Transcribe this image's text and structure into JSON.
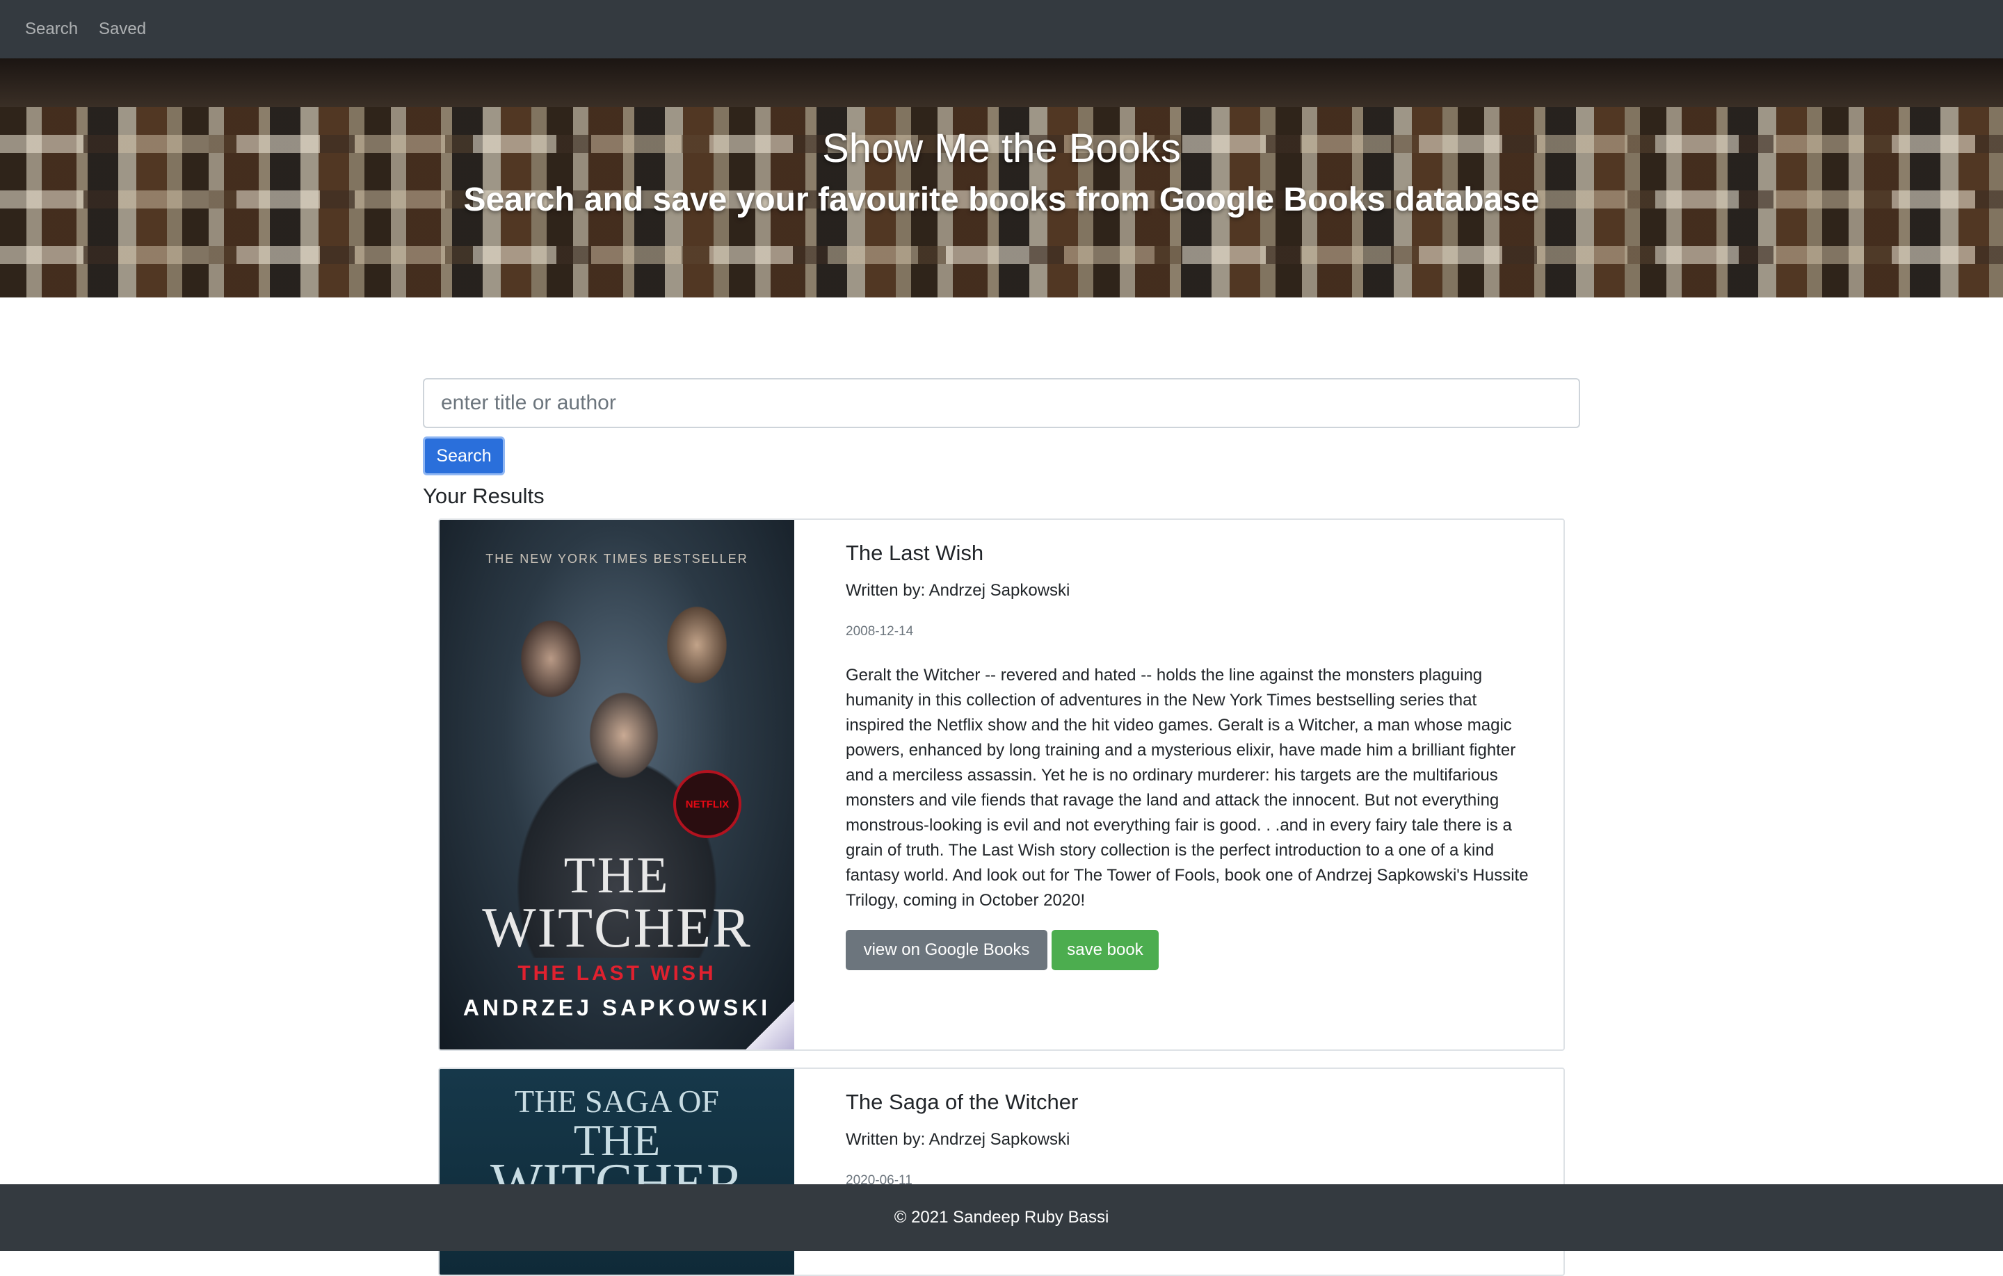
{
  "nav": {
    "items": [
      {
        "label": "Search"
      },
      {
        "label": "Saved"
      }
    ]
  },
  "hero": {
    "title": "Show Me the Books",
    "subtitle": "Search and save your favourite books from Google Books database"
  },
  "search": {
    "placeholder": "enter title or author",
    "value": "",
    "button_label": "Search"
  },
  "results": {
    "heading": "Your Results",
    "books": [
      {
        "title": "The Last Wish",
        "author": "Written by: Andrzej Sapkowski",
        "date": "2008-12-14",
        "description": "Geralt the Witcher -- revered and hated -- holds the line against the monsters plaguing humanity in this collection of adventures in the New York Times bestselling series that inspired the Netflix show and the hit video games. Geralt is a Witcher, a man whose magic powers, enhanced by long training and a mysterious elixir, have made him a brilliant fighter and a merciless assassin. Yet he is no ordinary murderer: his targets are the multifarious monsters and vile fiends that ravage the land and attack the innocent. But not everything monstrous-looking is evil and not everything fair is good. . .and in every fairy tale there is a grain of truth. The Last Wish story collection is the perfect introduction to a one of a kind fantasy world. And look out for The Tower of Fools, book one of Andrzej Sapkowski's Hussite Trilogy, coming in October 2020!",
        "view_label": "view on Google Books",
        "save_label": "save book",
        "cover": {
          "tagline": "THE NEW YORK TIMES BESTSELLER",
          "badge": "NETFLIX",
          "line1": "THE",
          "line2": "WITCHER",
          "line3": "THE LAST WISH",
          "author": "ANDRZEJ SAPKOWSKI"
        }
      },
      {
        "title": "The Saga of the Witcher",
        "author": "Written by: Andrzej Sapkowski",
        "date": "2020-06-11",
        "cover": {
          "line1": "THE SAGA OF",
          "line2": "THE",
          "line3": "WITCHER"
        }
      }
    ]
  },
  "footer": {
    "text": "© 2021 Sandeep Ruby Bassi"
  },
  "colors": {
    "navbar": "#343a40",
    "primary": "#2a6fdb",
    "secondary": "#6c757d",
    "success": "#4cad4f"
  }
}
